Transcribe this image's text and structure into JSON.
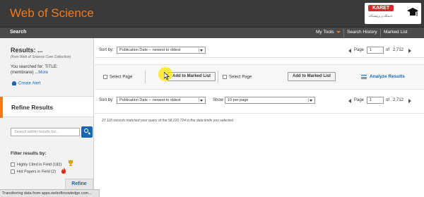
{
  "app": {
    "title": "Web of Science",
    "brand_color": "#f07a1c",
    "link_color": "#1a66b3",
    "watermark": {
      "name": "KARET",
      "sub": "دانشگاه و پژوهشگاه"
    }
  },
  "nav": {
    "search_tab": "Search",
    "items": [
      "My Tools",
      "Search History",
      "Marked List"
    ]
  },
  "sidebar": {
    "results_title": "Results: ...",
    "results_sub": "(from Web of Science Core Collection)",
    "searched_line1": "You searched for: TITLE:",
    "searched_line2": "(membrane) ...",
    "more_link": "More",
    "create_alert": "Create Alert",
    "refine_heading": "Refine Results",
    "search_within_placeholder": "Search within results for...",
    "filter_heading": "Filter results by:",
    "filters": [
      {
        "label": "Highly Cited in Field (182)",
        "icon": "trophy-icon"
      },
      {
        "label": "Hot Papers in Field (2)",
        "icon": "flame-icon"
      }
    ],
    "refine_button": "Refine"
  },
  "toolbar": {
    "sort_label": "Sort by:",
    "sort_value": "Publication Date -- newest to oldest",
    "page_label": "Page",
    "page_value": "1",
    "page_of": "of",
    "page_total": "2,712",
    "select_page": "Select Page",
    "add_marked": "Add to Marked List",
    "analyze": "Analyze Results",
    "show_label": "Show",
    "show_value": "10 per page"
  },
  "results": {
    "matched_text": "27,118 records matched your query of the 58,220,724 in the data limits you selected."
  },
  "status_bar": {
    "text": "Transferring data from apps.webofknowledge.com..."
  }
}
